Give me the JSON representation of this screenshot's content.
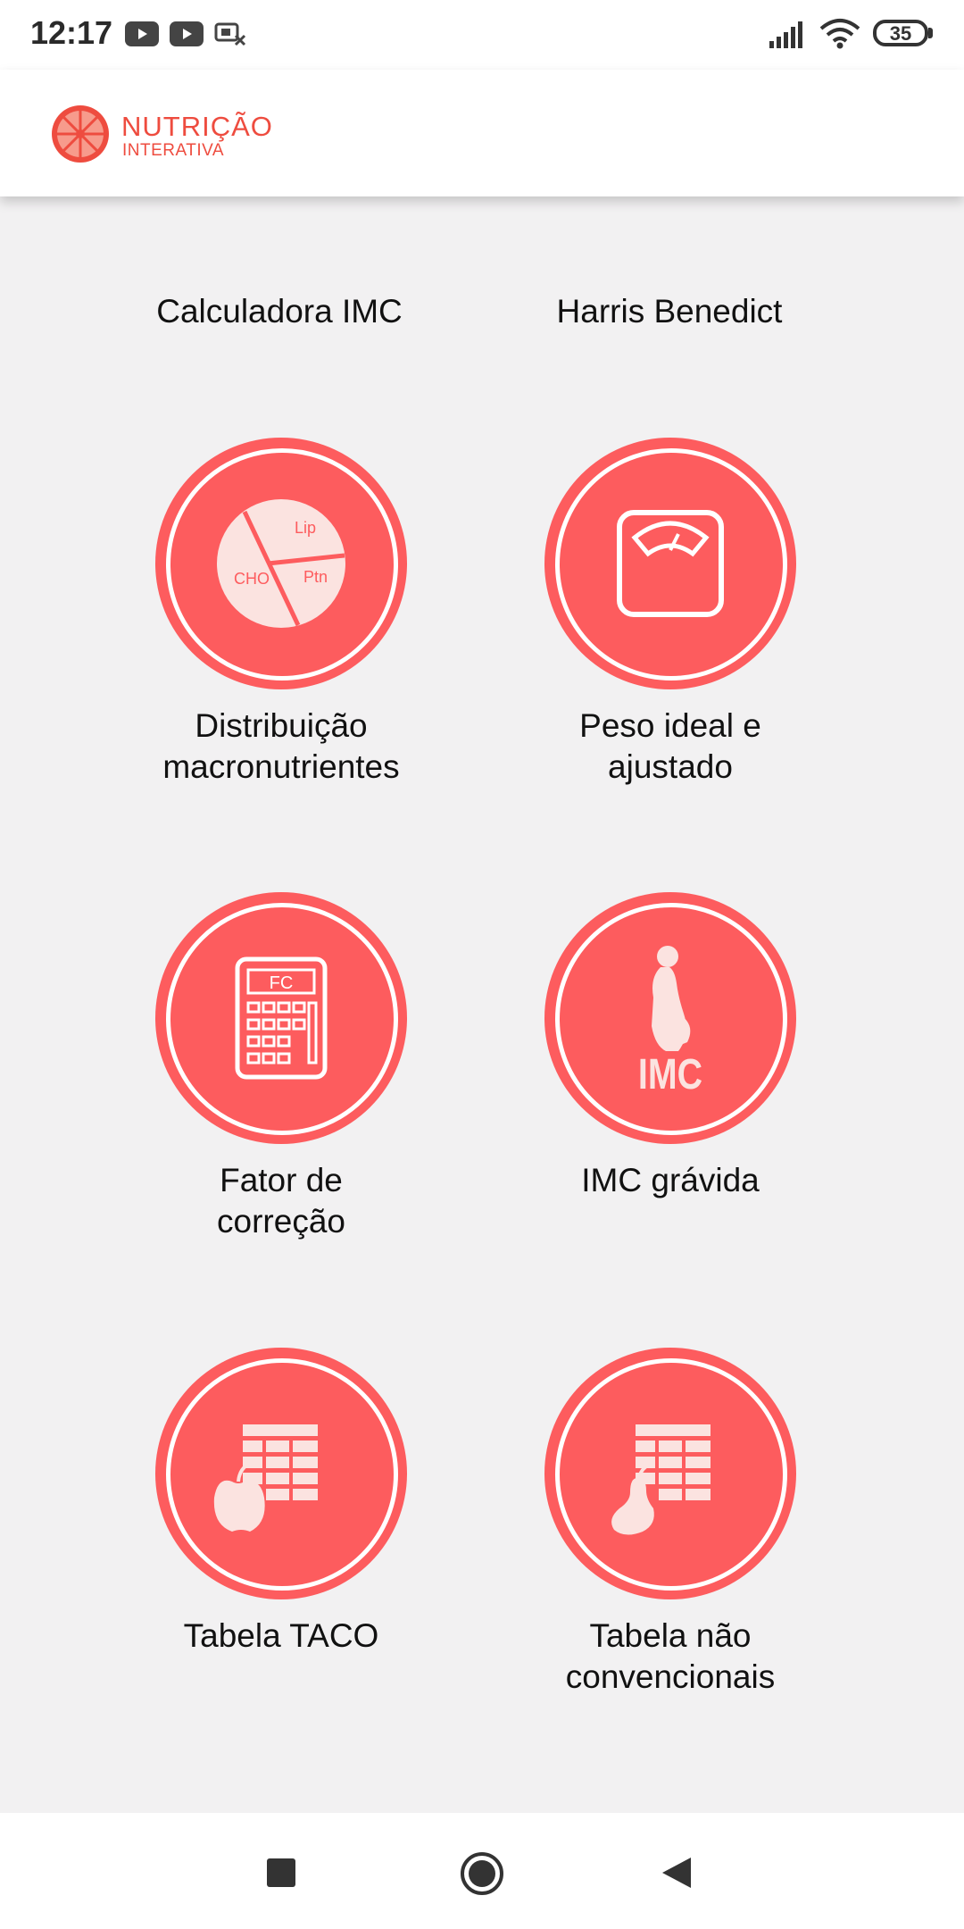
{
  "status_bar": {
    "time": "12:17",
    "battery": "35",
    "icons": [
      "youtube-icon",
      "youtube-icon",
      "cast-icon",
      "signal-icon",
      "wifi-icon",
      "battery-icon"
    ]
  },
  "app_bar": {
    "logo_line1": "NUTRIÇÃO",
    "logo_line2": "INTERATIVA",
    "accent_color": "#ee4c3f"
  },
  "menu": {
    "top_links": [
      "Calculadora IMC",
      "Harris Benedict"
    ],
    "tiles": [
      {
        "label_line1": "Distribuição",
        "label_line2": "macronutrientes",
        "icon": "pie-chart-icon",
        "pie_labels": [
          "Lip",
          "CHO",
          "Ptn"
        ]
      },
      {
        "label_line1": "Peso ideal e",
        "label_line2": "ajustado",
        "icon": "scale-icon"
      },
      {
        "label_line1": "Fator de",
        "label_line2": "correção",
        "icon": "calculator-icon",
        "icon_text": "FC"
      },
      {
        "label_line1": "IMC grávida",
        "label_line2": "",
        "icon": "pregnant-woman-icon",
        "icon_text": "IMC"
      },
      {
        "label_line1": "Tabela TACO",
        "label_line2": "",
        "icon": "table-apple-icon"
      },
      {
        "label_line1": "Tabela não",
        "label_line2": "convencionais",
        "icon": "table-pear-icon"
      }
    ],
    "tile_color": "#fd5c5e"
  },
  "nav_bar": {
    "buttons": [
      "recents-button",
      "home-button",
      "back-button"
    ]
  }
}
